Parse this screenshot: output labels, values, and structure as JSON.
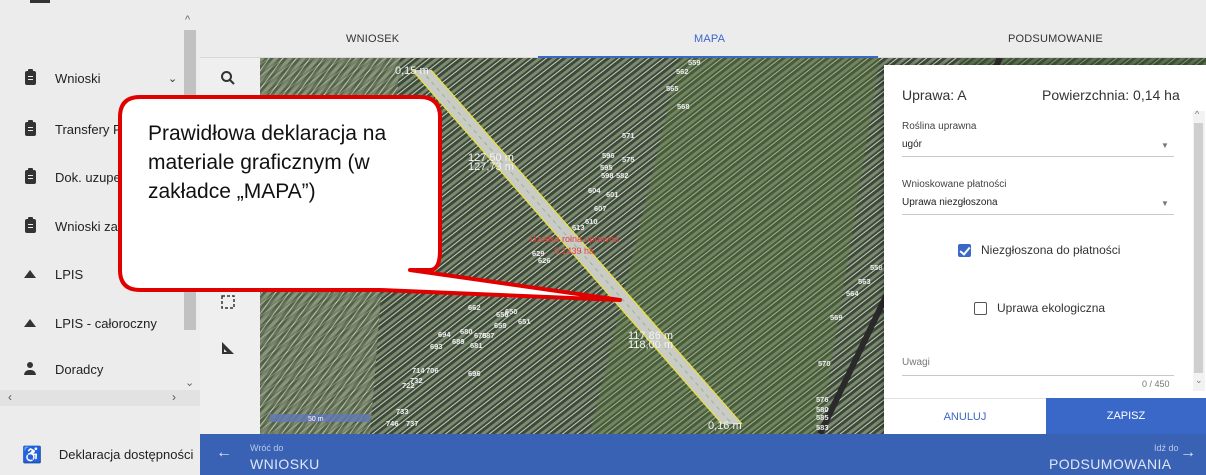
{
  "sidebar": {
    "items": [
      {
        "label": "Wnioski",
        "icon": "clipboard-icon",
        "expandable": true
      },
      {
        "label": "Transfery P",
        "icon": "clipboard-icon"
      },
      {
        "label": "Dok. uzupe",
        "icon": "clipboard-icon"
      },
      {
        "label": "Wnioski za",
        "icon": "clipboard-icon"
      },
      {
        "label": "LPIS",
        "icon": "mountain-icon"
      },
      {
        "label": "LPIS - całoroczny",
        "icon": "mountain-icon"
      },
      {
        "label": "Doradcy",
        "icon": "person-icon"
      }
    ],
    "accessibility_label": "Deklaracja dostępności"
  },
  "tabs": [
    {
      "label": "WNIOSEK",
      "active": false
    },
    {
      "label": "MAPA",
      "active": true
    },
    {
      "label": "PODSUMOWANIE",
      "active": false
    }
  ],
  "map": {
    "scale_label": "50 m",
    "labels": {
      "len_top": "0,15 m",
      "len_upper_left_a": "127,50 m",
      "len_upper_left_b": "127,73 m",
      "len_mid_right_a": "117,86 m",
      "len_mid_right_b": "118,00 m",
      "len_bottom": "0,16 m",
      "parcel_note_a": "Działka rolna uprawna",
      "parcel_note_b": "0,1439 ha",
      "n559": "559",
      "n562": "562",
      "n565": "565",
      "n568": "568",
      "n571": "571",
      "n595": "595",
      "n596": "596",
      "n575": "575",
      "n598": "598",
      "n582": "582",
      "n604": "604",
      "n601": "601",
      "n607": "607",
      "n610": "610",
      "n613": "613",
      "n626": "626",
      "n629": "629",
      "n654": "654",
      "n639": "639",
      "n647": "647",
      "n662": "662",
      "n656": "656",
      "n650": "650",
      "n651": "651",
      "n659": "659",
      "n694": "694",
      "n680": "680",
      "n675": "675",
      "n687": "687",
      "n693": "693",
      "n689": "689",
      "n681": "681",
      "n714": "714",
      "n706": "706",
      "n696": "696",
      "n722": "722",
      "n732": "732",
      "n733": "733",
      "n746": "746",
      "n737": "737",
      "n558": "558",
      "n563": "563",
      "n564": "564",
      "n569": "569",
      "n570": "570",
      "n576": "576",
      "n580": "580",
      "n585": "585",
      "n583": "583"
    }
  },
  "popup": {
    "title": "Uprawa: A",
    "area": "Powierzchnia: 0,14 ha",
    "crop_label": "Roślina uprawna",
    "crop_value": "ugór",
    "payment_label": "Wnioskowane płatności",
    "payment_value": "Uprawa niezgłoszona",
    "checkbox_not_declared": "Niezgłoszona do płatności",
    "checkbox_not_declared_checked": true,
    "checkbox_eco": "Uprawa ekologiczna",
    "checkbox_eco_checked": false,
    "notes_label": "Uwagi",
    "notes_counter": "0 / 450",
    "cancel_label": "ANULUJ",
    "save_label": "ZAPISZ"
  },
  "bottom_nav": {
    "back_small": "Wróć do",
    "back_big": "WNIOSKU",
    "next_small": "Idź do",
    "next_big": "PODSUMOWANIA"
  },
  "callout": {
    "text": "Prawidłowa deklaracja na materiale graficznym (w zakładce „MAPA”)"
  },
  "colors": {
    "accent": "#3a68c9",
    "bottom_bar": "#3a62b4",
    "callout_border": "#e00000",
    "parcel_outline": "#e8e23a"
  }
}
